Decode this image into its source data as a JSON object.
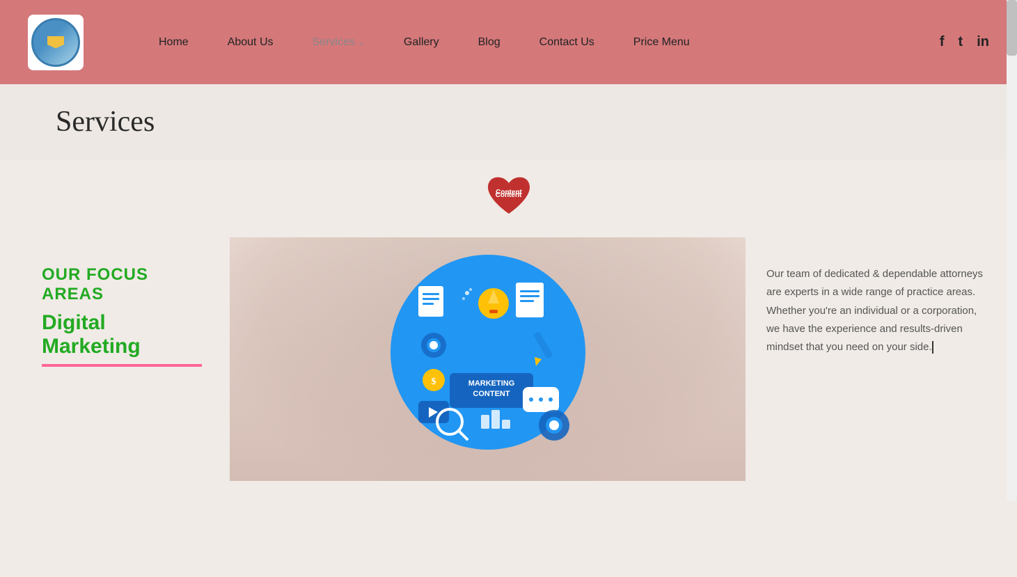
{
  "header": {
    "logo_alt": "Company Logo",
    "nav": {
      "home": "Home",
      "about": "About Us",
      "services": "Services",
      "services_has_dropdown": true,
      "gallery": "Gallery",
      "blog": "Blog",
      "contact": "Contact Us",
      "price_menu": "Price Menu"
    },
    "social": {
      "facebook": "f",
      "twitter": "t",
      "linkedin": "in"
    }
  },
  "page_title": "Services",
  "heart_badge": {
    "label": "Content"
  },
  "left_column": {
    "focus_title": "OUR FOCUS AREAS",
    "focus_subtitle": "Digital Marketing"
  },
  "center_image": {
    "alt": "Marketing Content circle with icons"
  },
  "marketing_circle": {
    "line1": "MARKETING",
    "line2": "CONTENT"
  },
  "right_column": {
    "text": "Our team of dedicated & dependable attorneys are experts in a wide range of practice areas. Whether you're an individual or a corporation, we have the experience and results-driven mindset that you need on your side."
  }
}
